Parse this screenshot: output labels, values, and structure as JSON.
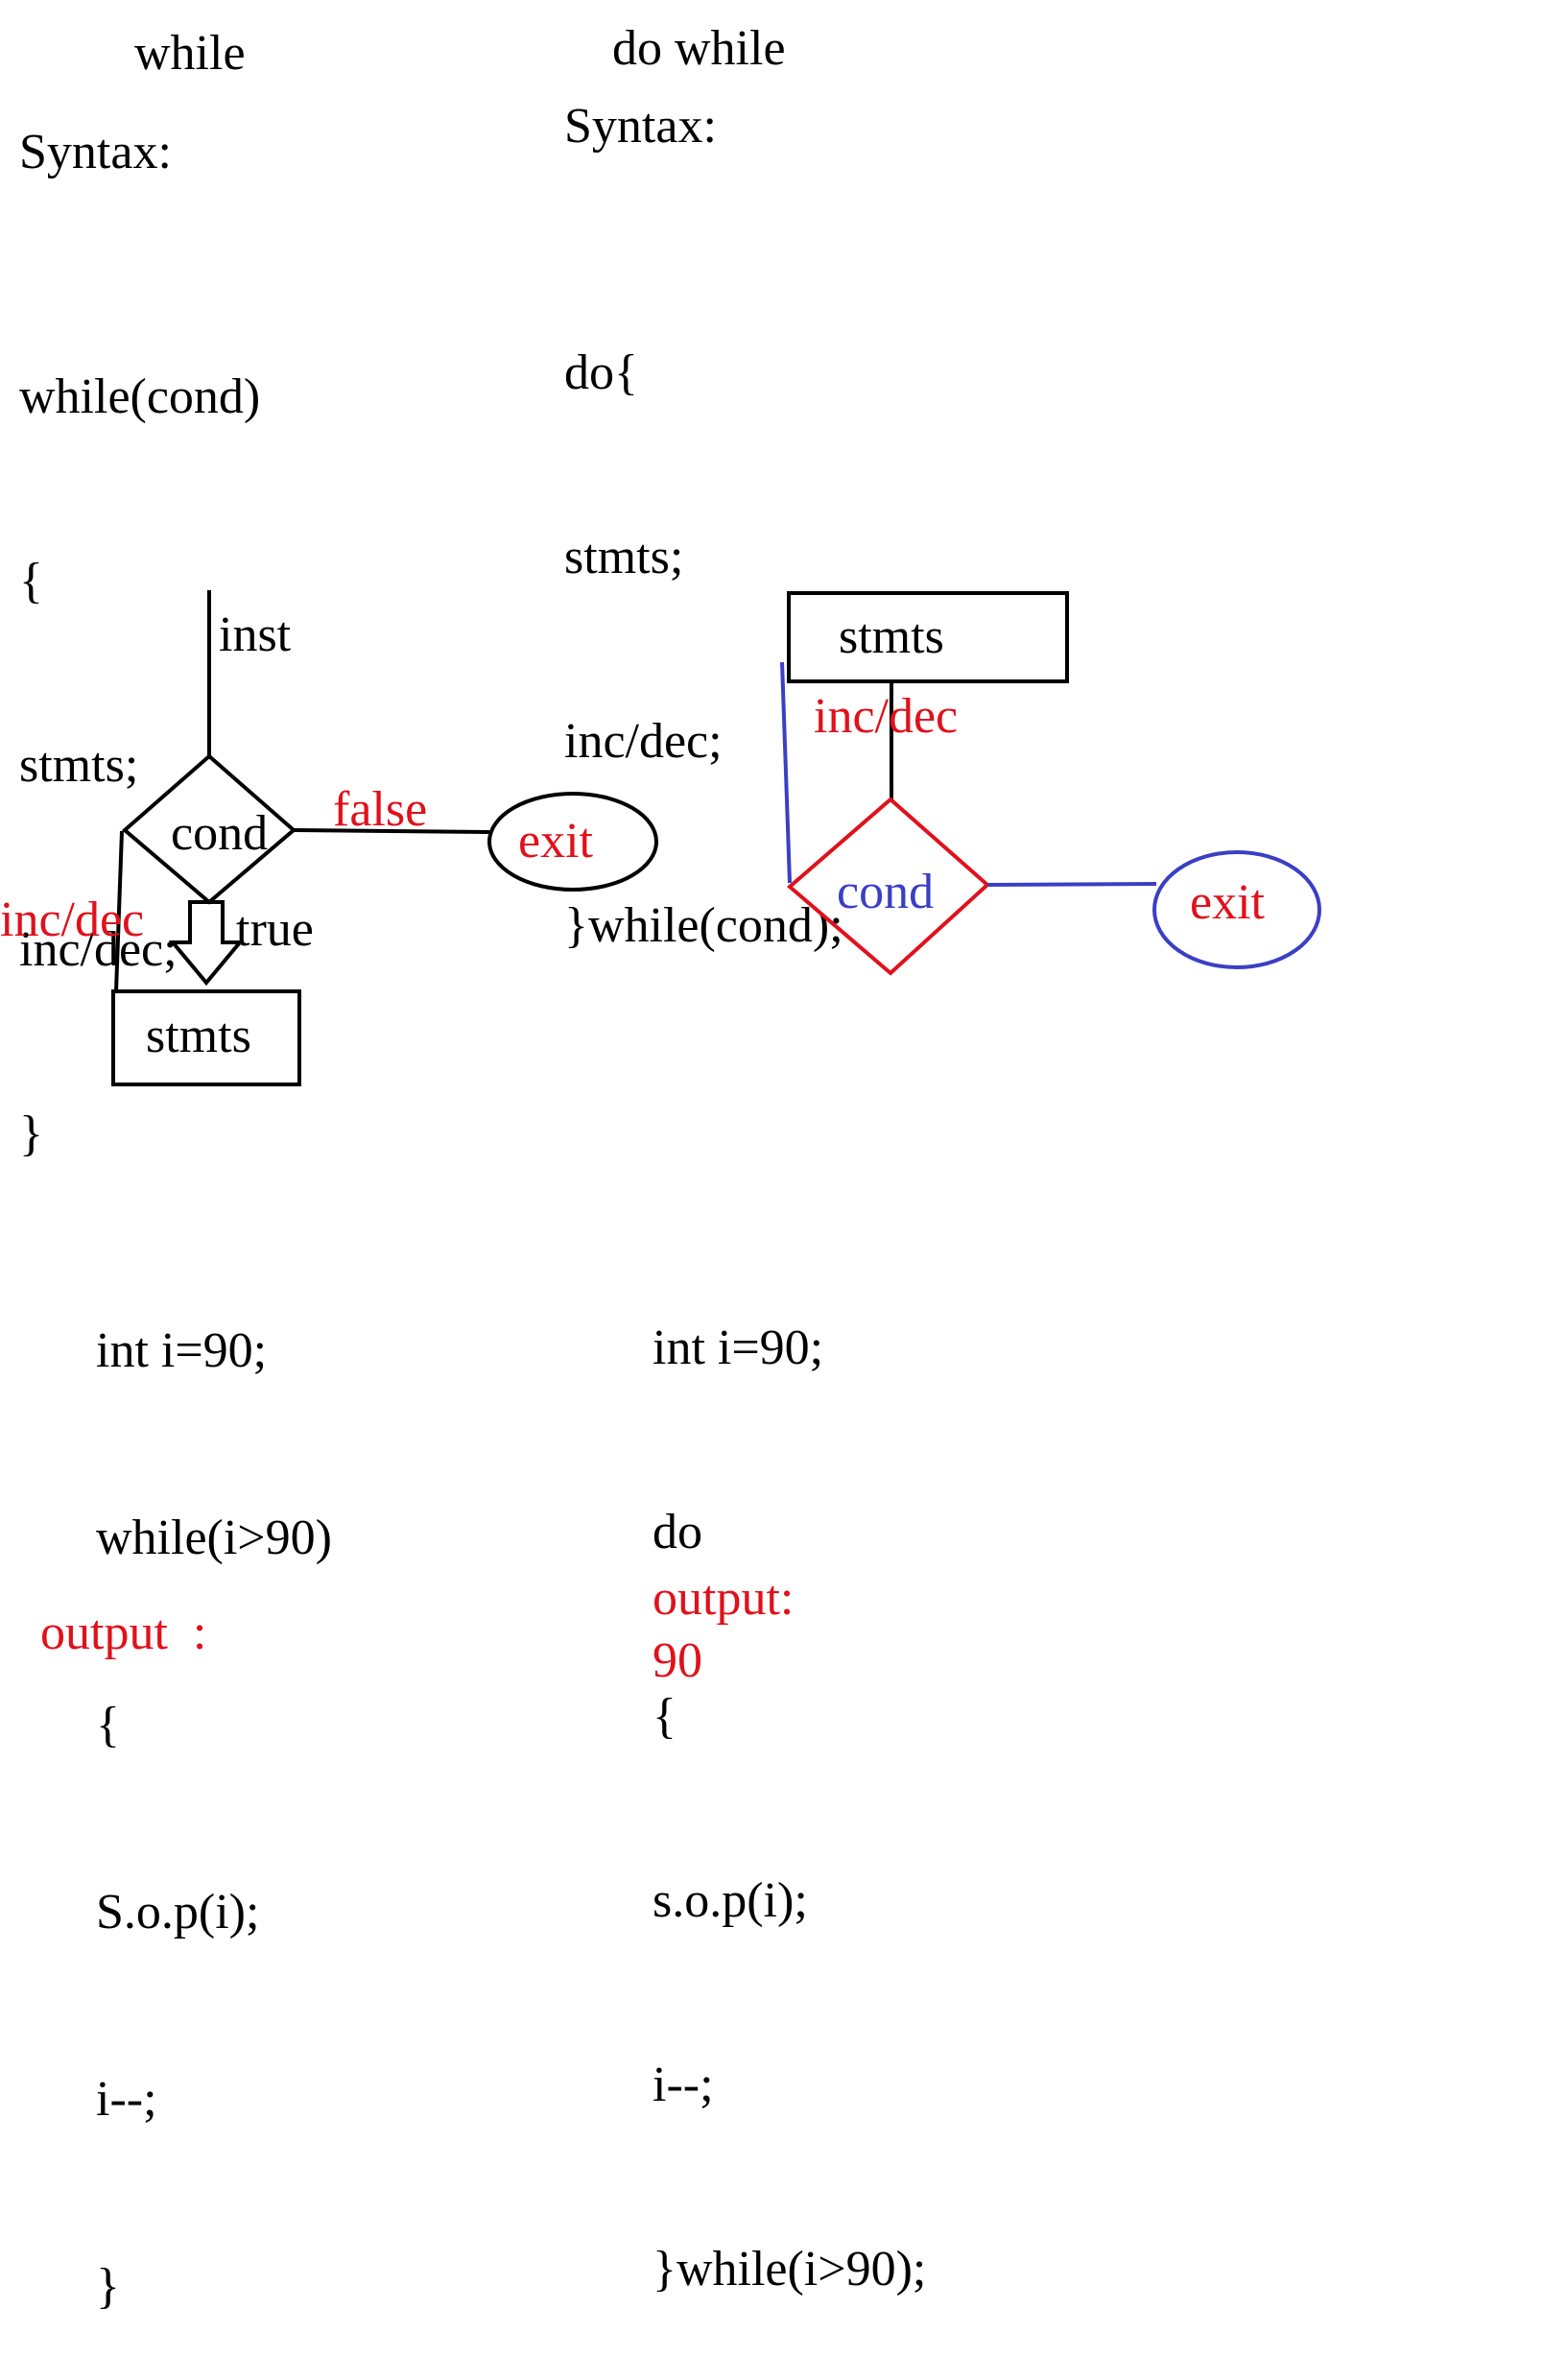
{
  "while_section": {
    "heading": "while",
    "syntax_label": "Syntax:",
    "syntax_lines": [
      "while(cond)",
      "{",
      "stmts;",
      "inc/dec;",
      "}"
    ],
    "flowchart": {
      "inst_label": "inst",
      "cond_label": "cond",
      "false_label": "false",
      "exit_label": "exit",
      "incdec_label": "inc/dec",
      "true_label": "true",
      "stmts_label": "stmts"
    },
    "example_lines": [
      "int i=90;",
      "while(i>90)",
      "{",
      "S.o.p(i);",
      "i--;",
      "}"
    ],
    "output_label": "output  :"
  },
  "do_while_section": {
    "heading": "do while",
    "syntax_label": "Syntax:",
    "syntax_lines": [
      "do{",
      "stmts;",
      "inc/dec;",
      "}while(cond);"
    ],
    "flowchart": {
      "stmts_label": "stmts",
      "incdec_label": "inc/dec",
      "cond_label": "cond",
      "exit_label": "exit"
    },
    "example_lines": [
      "int i=90;",
      "do",
      "{",
      "s.o.p(i);",
      "i--;",
      "}while(i>90);"
    ],
    "output_label": "output:",
    "output_value": "90"
  },
  "colors": {
    "black": "#000000",
    "red": "#e0111b",
    "blue": "#3b3fc4"
  }
}
